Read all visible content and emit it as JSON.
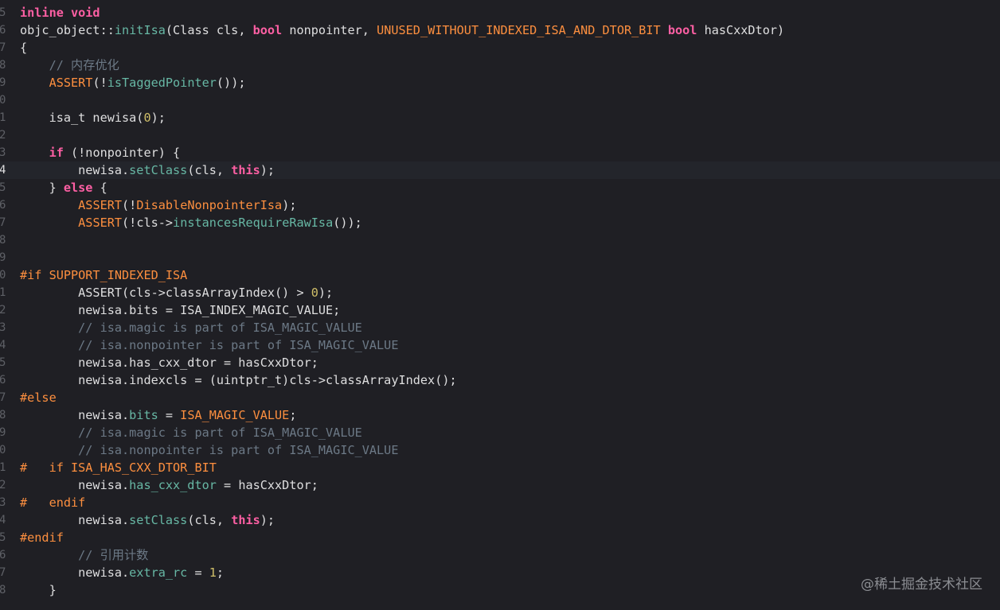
{
  "colors": {
    "background": "#1f1f24",
    "current_line": "#23252b",
    "keyword": "#fc5fa3",
    "function": "#67b7a4",
    "preprocessor": "#fd8f3f",
    "number": "#d0bf69",
    "comment": "#6c7986",
    "plain": "#dfdfe0"
  },
  "editor": {
    "lines": [
      {
        "num": "5",
        "tokens": [
          {
            "t": "inline void",
            "c": "kw"
          }
        ]
      },
      {
        "num": "6",
        "tokens": [
          {
            "t": "objc_object::",
            "c": "plain"
          },
          {
            "t": "initIsa",
            "c": "fn"
          },
          {
            "t": "(Class cls, ",
            "c": "plain"
          },
          {
            "t": "bool",
            "c": "kw"
          },
          {
            "t": " nonpointer, ",
            "c": "plain"
          },
          {
            "t": "UNUSED_WITHOUT_INDEXED_ISA_AND_DTOR_BIT",
            "c": "pp"
          },
          {
            "t": " ",
            "c": "plain"
          },
          {
            "t": "bool",
            "c": "kw"
          },
          {
            "t": " hasCxxDtor)",
            "c": "plain"
          }
        ]
      },
      {
        "num": "7",
        "tokens": [
          {
            "t": "{",
            "c": "plain"
          }
        ]
      },
      {
        "num": "8",
        "tokens": [
          {
            "t": "    // 内存优化",
            "c": "cm"
          }
        ]
      },
      {
        "num": "9",
        "tokens": [
          {
            "t": "    ",
            "c": "plain"
          },
          {
            "t": "ASSERT",
            "c": "pp"
          },
          {
            "t": "(!",
            "c": "plain"
          },
          {
            "t": "isTaggedPointer",
            "c": "fn"
          },
          {
            "t": "());",
            "c": "plain"
          }
        ]
      },
      {
        "num": "0",
        "tokens": []
      },
      {
        "num": "1",
        "tokens": [
          {
            "t": "    isa_t newisa(",
            "c": "plain"
          },
          {
            "t": "0",
            "c": "num"
          },
          {
            "t": ");",
            "c": "plain"
          }
        ]
      },
      {
        "num": "2",
        "tokens": []
      },
      {
        "num": "3",
        "tokens": [
          {
            "t": "    ",
            "c": "plain"
          },
          {
            "t": "if",
            "c": "kw"
          },
          {
            "t": " (!nonpointer) {",
            "c": "plain"
          }
        ]
      },
      {
        "num": "4",
        "current": true,
        "tokens": [
          {
            "t": "        newisa.",
            "c": "plain"
          },
          {
            "t": "setClass",
            "c": "fn"
          },
          {
            "t": "(cls, ",
            "c": "plain"
          },
          {
            "t": "this",
            "c": "kw"
          },
          {
            "t": ");",
            "c": "plain"
          }
        ]
      },
      {
        "num": "5",
        "tokens": [
          {
            "t": "    } ",
            "c": "plain"
          },
          {
            "t": "else",
            "c": "kw"
          },
          {
            "t": " {",
            "c": "plain"
          }
        ]
      },
      {
        "num": "6",
        "tokens": [
          {
            "t": "        ",
            "c": "plain"
          },
          {
            "t": "ASSERT",
            "c": "pp"
          },
          {
            "t": "(!",
            "c": "plain"
          },
          {
            "t": "DisableNonpointerIsa",
            "c": "pp"
          },
          {
            "t": ");",
            "c": "plain"
          }
        ]
      },
      {
        "num": "7",
        "tokens": [
          {
            "t": "        ",
            "c": "plain"
          },
          {
            "t": "ASSERT",
            "c": "pp"
          },
          {
            "t": "(!cls->",
            "c": "plain"
          },
          {
            "t": "instancesRequireRawIsa",
            "c": "fn"
          },
          {
            "t": "());",
            "c": "plain"
          }
        ]
      },
      {
        "num": "8",
        "tokens": []
      },
      {
        "num": "9",
        "tokens": []
      },
      {
        "num": "0",
        "tokens": [
          {
            "t": "#if SUPPORT_INDEXED_ISA",
            "c": "pp"
          }
        ]
      },
      {
        "num": "1",
        "tokens": [
          {
            "t": "        ASSERT(cls->classArrayIndex() > ",
            "c": "plain"
          },
          {
            "t": "0",
            "c": "num"
          },
          {
            "t": ");",
            "c": "plain"
          }
        ]
      },
      {
        "num": "2",
        "tokens": [
          {
            "t": "        newisa.bits = ISA_INDEX_MAGIC_VALUE;",
            "c": "plain"
          }
        ]
      },
      {
        "num": "3",
        "tokens": [
          {
            "t": "        // isa.magic is part of ISA_MAGIC_VALUE",
            "c": "cm"
          }
        ]
      },
      {
        "num": "4",
        "tokens": [
          {
            "t": "        // isa.nonpointer is part of ISA_MAGIC_VALUE",
            "c": "cm"
          }
        ]
      },
      {
        "num": "5",
        "tokens": [
          {
            "t": "        newisa.has_cxx_dtor = hasCxxDtor;",
            "c": "plain"
          }
        ]
      },
      {
        "num": "6",
        "tokens": [
          {
            "t": "        newisa.indexcls = (uintptr_t)cls->classArrayIndex();",
            "c": "plain"
          }
        ]
      },
      {
        "num": "7",
        "tokens": [
          {
            "t": "#else",
            "c": "pp"
          }
        ]
      },
      {
        "num": "8",
        "tokens": [
          {
            "t": "        newisa.",
            "c": "plain"
          },
          {
            "t": "bits",
            "c": "fn"
          },
          {
            "t": " = ",
            "c": "plain"
          },
          {
            "t": "ISA_MAGIC_VALUE",
            "c": "pp"
          },
          {
            "t": ";",
            "c": "plain"
          }
        ]
      },
      {
        "num": "9",
        "tokens": [
          {
            "t": "        // isa.magic is part of ISA_MAGIC_VALUE",
            "c": "cm"
          }
        ]
      },
      {
        "num": "0",
        "tokens": [
          {
            "t": "        // isa.nonpointer is part of ISA_MAGIC_VALUE",
            "c": "cm"
          }
        ]
      },
      {
        "num": "1",
        "tokens": [
          {
            "t": "#   if ISA_HAS_CXX_DTOR_BIT",
            "c": "pp"
          }
        ]
      },
      {
        "num": "2",
        "tokens": [
          {
            "t": "        newisa.",
            "c": "plain"
          },
          {
            "t": "has_cxx_dtor",
            "c": "fn"
          },
          {
            "t": " = hasCxxDtor;",
            "c": "plain"
          }
        ]
      },
      {
        "num": "3",
        "tokens": [
          {
            "t": "#   endif",
            "c": "pp"
          }
        ]
      },
      {
        "num": "4",
        "tokens": [
          {
            "t": "        newisa.",
            "c": "plain"
          },
          {
            "t": "setClass",
            "c": "fn"
          },
          {
            "t": "(cls, ",
            "c": "plain"
          },
          {
            "t": "this",
            "c": "kw"
          },
          {
            "t": ");",
            "c": "plain"
          }
        ]
      },
      {
        "num": "5",
        "tokens": [
          {
            "t": "#endif",
            "c": "pp"
          }
        ]
      },
      {
        "num": "6",
        "tokens": [
          {
            "t": "        // 引用计数",
            "c": "cm"
          }
        ]
      },
      {
        "num": "7",
        "tokens": [
          {
            "t": "        newisa.",
            "c": "plain"
          },
          {
            "t": "extra_rc",
            "c": "fn"
          },
          {
            "t": " = ",
            "c": "plain"
          },
          {
            "t": "1",
            "c": "num"
          },
          {
            "t": ";",
            "c": "plain"
          }
        ]
      },
      {
        "num": "8",
        "tokens": [
          {
            "t": "    }",
            "c": "plain"
          }
        ]
      }
    ]
  },
  "watermark": "@稀土掘金技术社区"
}
